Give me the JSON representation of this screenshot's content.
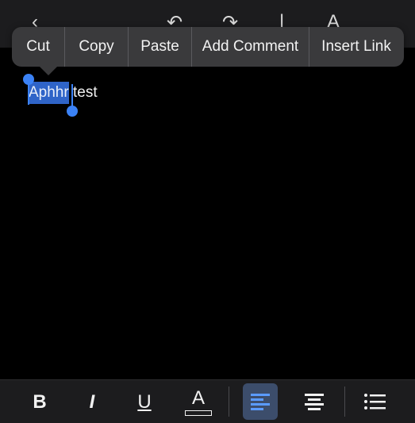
{
  "context_menu": {
    "items": [
      {
        "label": "Cut"
      },
      {
        "label": "Copy"
      },
      {
        "label": "Paste"
      },
      {
        "label": "Add Comment"
      },
      {
        "label": "Insert Link"
      }
    ]
  },
  "document": {
    "selected_text": "Aphhr",
    "rest_text": " test"
  },
  "toolbar": {
    "bold_label": "B",
    "italic_label": "I",
    "underline_label": "U",
    "text_color_label": "A",
    "align_left_active": true
  },
  "colors": {
    "accent": "#3b82f6",
    "selection": "#2f64c8",
    "menu_bg": "#3a3a3c",
    "toolbar_bg": "#1c1c1e"
  }
}
